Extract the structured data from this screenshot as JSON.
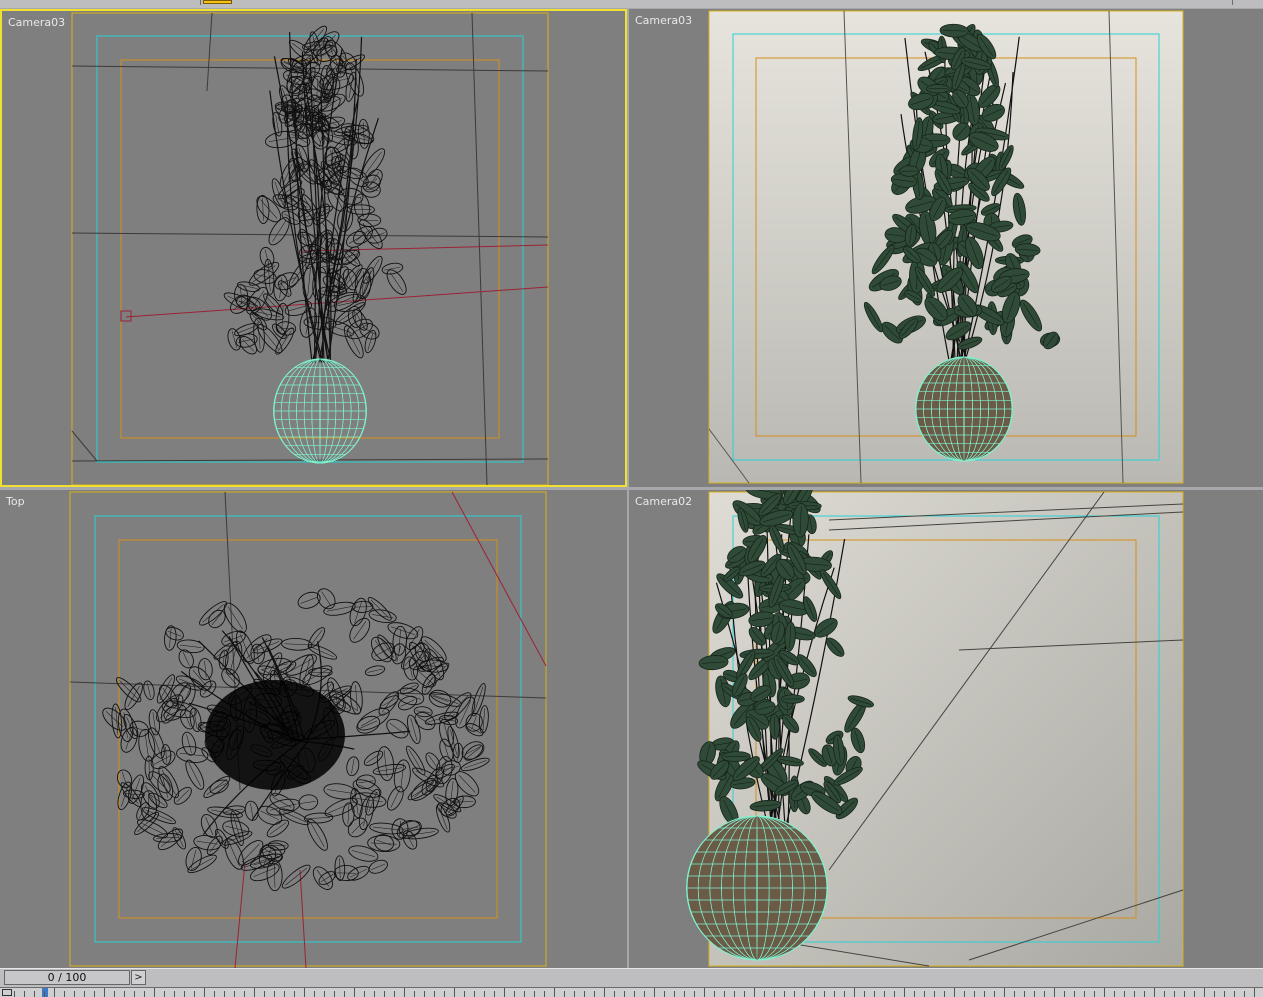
{
  "viewports": [
    {
      "id": "top-left",
      "label": "Camera03",
      "mode": "wireframe",
      "active": true
    },
    {
      "id": "top-right",
      "label": "Camera03",
      "mode": "shaded",
      "active": false
    },
    {
      "id": "bottom-left",
      "label": "Top",
      "mode": "wireframe",
      "active": false
    },
    {
      "id": "bottom-right",
      "label": "Camera02",
      "mode": "shaded",
      "active": false
    }
  ],
  "time_slider": {
    "label": "0 / 100",
    "frame": 0,
    "total": 100,
    "next_glyph": ">"
  },
  "colors": {
    "viewport_bg": "#7f7f7f",
    "active_border": "#f0e030",
    "safe_frame_outer": "#d9b21a",
    "safe_frame_action": "#2ad1d6",
    "safe_frame_title": "#d4901a",
    "pot_wire": "#7ff3d0",
    "foliage": "#2f4a36",
    "camera_line": "#9b2236"
  }
}
